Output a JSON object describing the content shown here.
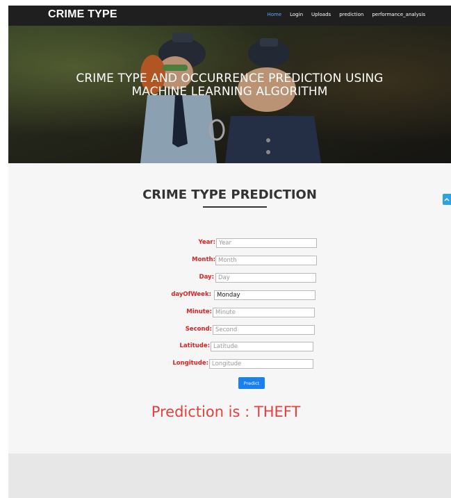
{
  "navbar": {
    "brand": "CRIME TYPE",
    "links": [
      {
        "label": "Home",
        "active": true
      },
      {
        "label": "Login"
      },
      {
        "label": "Uploads"
      },
      {
        "label": "prediction"
      },
      {
        "label": "performance_analysis"
      }
    ]
  },
  "hero": {
    "title_line1": "CRIME TYPE AND OCCURRENCE PREDICTION USING",
    "title_line2": "MACHINE LEARNING ALGORITHM"
  },
  "section": {
    "title": "CRIME TYPE PREDICTION"
  },
  "form": {
    "fields": [
      {
        "label": "Year:",
        "placeholder": "Year",
        "value": ""
      },
      {
        "label": "Month:",
        "placeholder": "Month",
        "value": ""
      },
      {
        "label": "Day:",
        "placeholder": "Day",
        "value": ""
      },
      {
        "label": "dayOfWeek:",
        "placeholder": "",
        "value": "Monday"
      },
      {
        "label": "Minute:",
        "placeholder": "Minute",
        "value": ""
      },
      {
        "label": "Second:",
        "placeholder": "Second",
        "value": ""
      },
      {
        "label": "Latitude:",
        "placeholder": "Latitude",
        "value": ""
      },
      {
        "label": "Longitude:",
        "placeholder": "Longitude",
        "value": ""
      }
    ],
    "submit_label": "Predict"
  },
  "result": {
    "text": "Prediction is : THEFT"
  },
  "colors": {
    "accent": "#1a7ff0",
    "label_red": "#d22222",
    "result_red": "#e0413d",
    "navbar_bg": "#1f1f1f"
  },
  "icons": {
    "scroll_top": "chevron-up-icon"
  }
}
